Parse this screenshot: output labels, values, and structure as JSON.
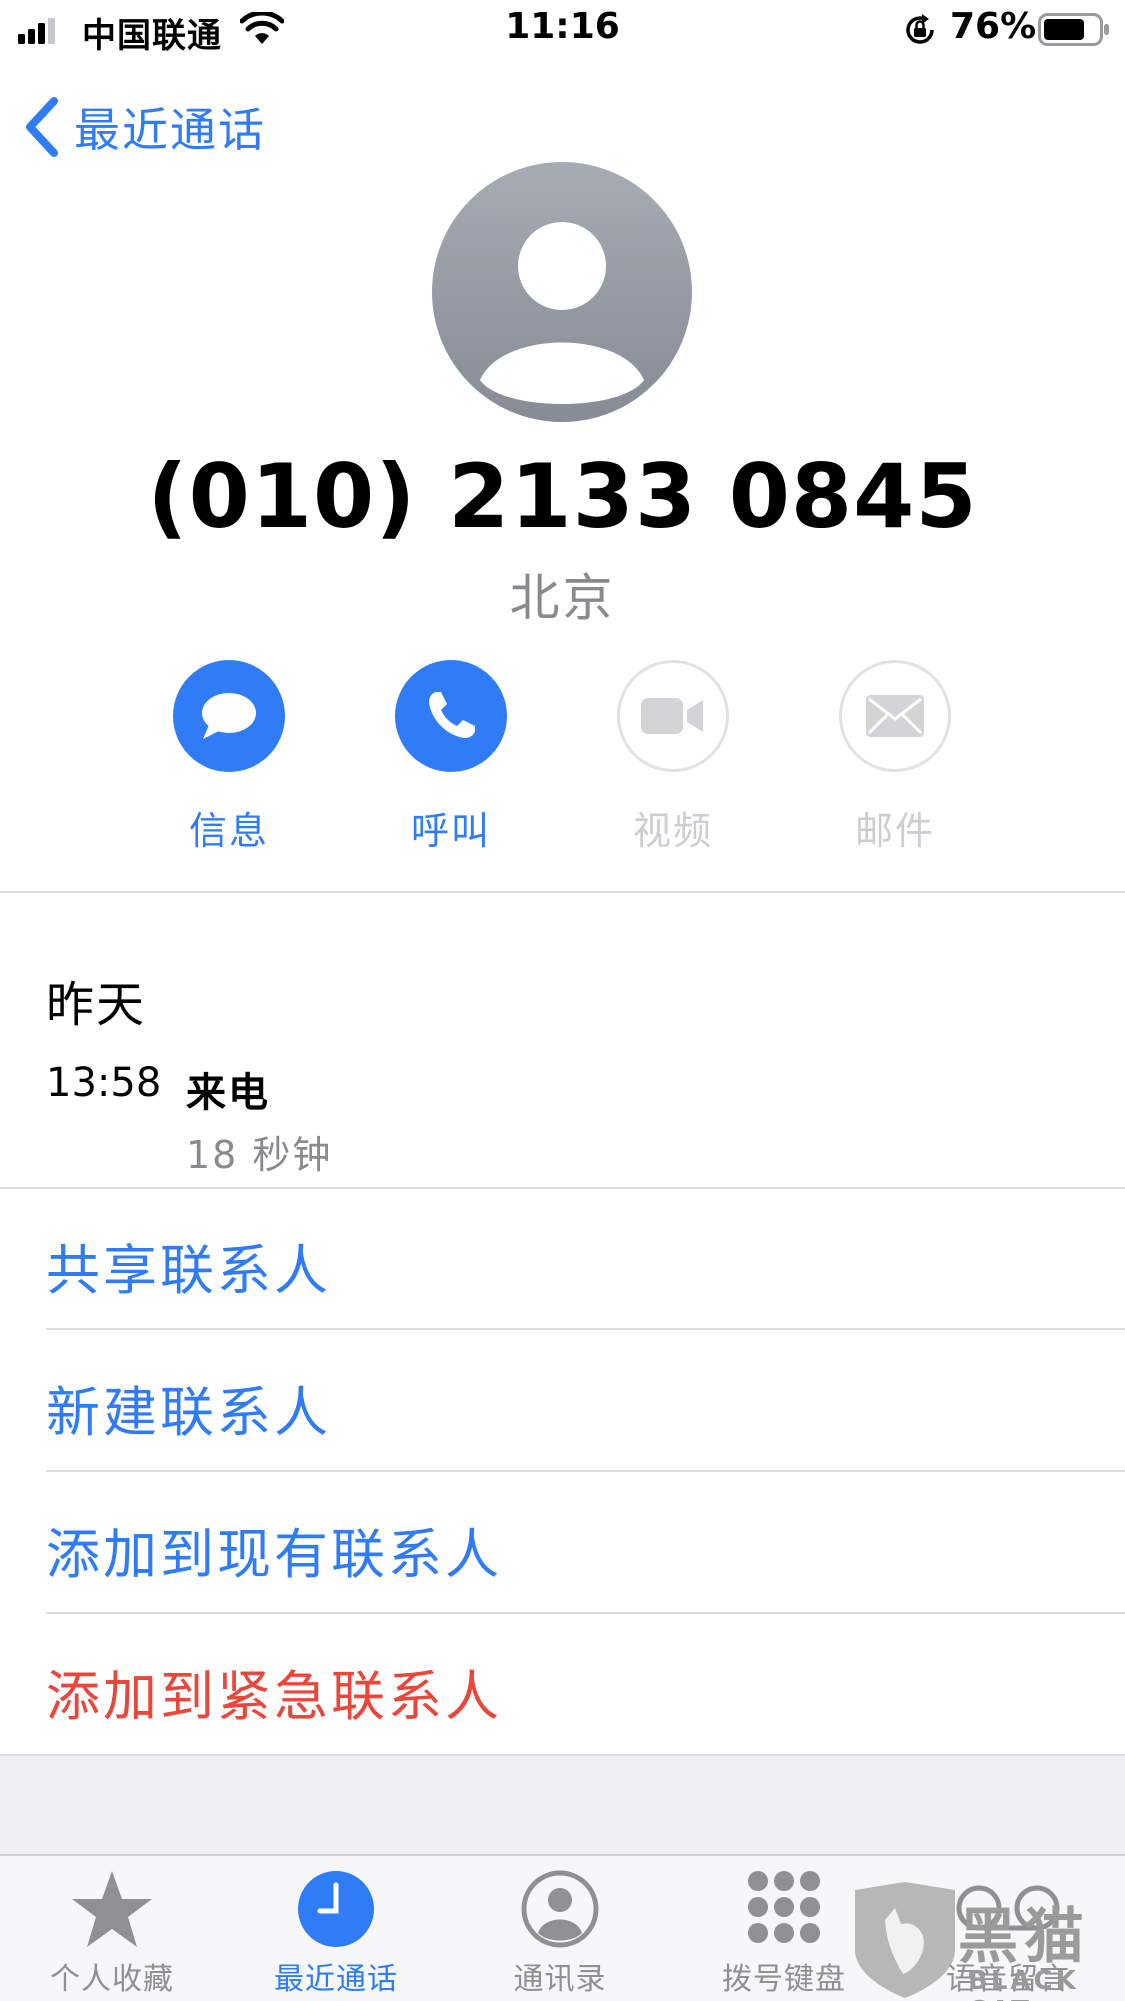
{
  "status_bar": {
    "carrier": "中国联通",
    "time": "11:16",
    "battery_percent": "76%",
    "battery_level": 0.76,
    "icons": [
      "signal-icon",
      "wifi-icon",
      "rotation-lock-icon",
      "battery-icon"
    ]
  },
  "nav": {
    "back_label": "最近通话",
    "back_icon": "chevron-left-icon"
  },
  "contact": {
    "phone_number": "(010) 2133 0845",
    "location": "北京",
    "avatar_icon": "person-silhouette-icon"
  },
  "actions": [
    {
      "label": "信息",
      "icon": "message-icon",
      "enabled": true
    },
    {
      "label": "呼叫",
      "icon": "phone-icon",
      "enabled": true
    },
    {
      "label": "视频",
      "icon": "video-icon",
      "enabled": false
    },
    {
      "label": "邮件",
      "icon": "mail-icon",
      "enabled": false
    }
  ],
  "history": {
    "date": "昨天",
    "entries": [
      {
        "time": "13:58",
        "type": "来电",
        "duration": "18 秒钟"
      }
    ]
  },
  "options": [
    {
      "label": "共享联系人",
      "style": "blue"
    },
    {
      "label": "新建联系人",
      "style": "blue"
    },
    {
      "label": "添加到现有联系人",
      "style": "blue"
    },
    {
      "label": "添加到紧急联系人",
      "style": "red"
    }
  ],
  "tabs": [
    {
      "label": "个人收藏",
      "icon": "star-icon",
      "active": false
    },
    {
      "label": "最近通话",
      "icon": "clock-icon",
      "active": true
    },
    {
      "label": "通讯录",
      "icon": "contacts-icon",
      "active": false
    },
    {
      "label": "拨号键盘",
      "icon": "keypad-icon",
      "active": false
    },
    {
      "label": "语音留言",
      "icon": "voicemail-icon",
      "active": false
    }
  ],
  "watermark": {
    "text": "黑猫",
    "subtext": "BLACK CAT",
    "icon": "black-cat-logo-icon"
  },
  "colors": {
    "accent": "#2f7cf6",
    "destructive": "#e9473b",
    "secondary_text": "#8a8a8e",
    "disabled": "#cdcdd2"
  }
}
